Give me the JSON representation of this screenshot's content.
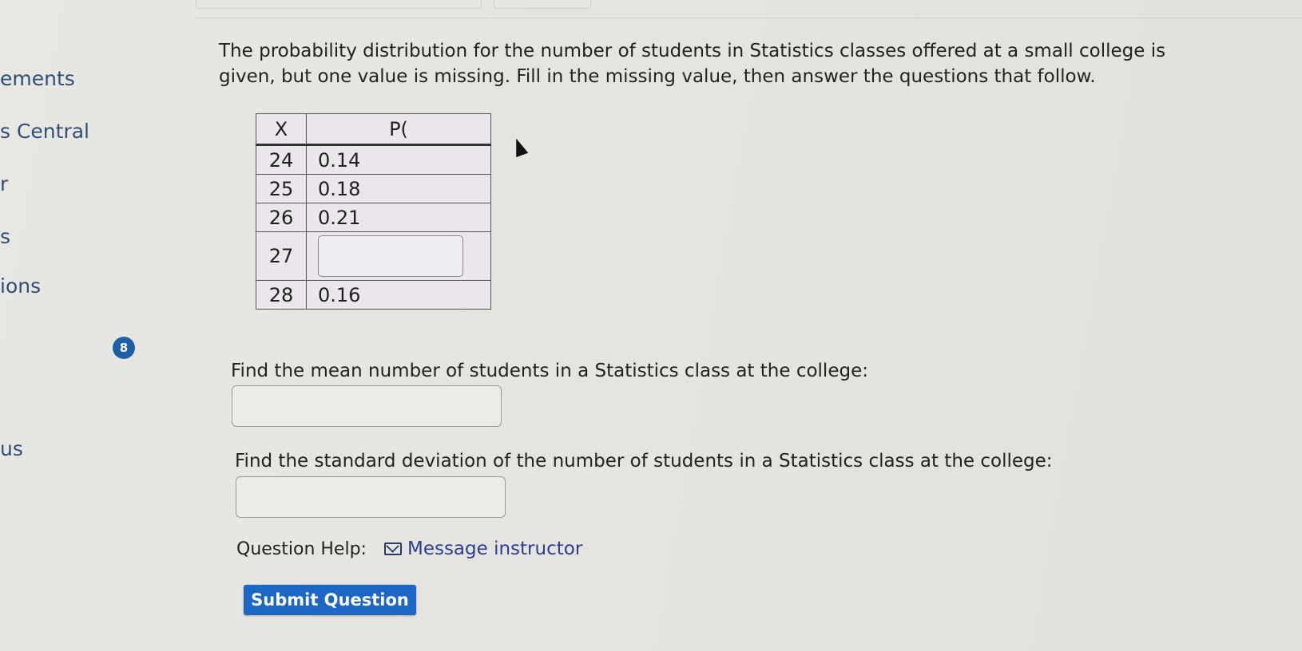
{
  "sidebar": {
    "items": [
      "ements",
      "s Central",
      "r",
      "s",
      "ions",
      "us"
    ]
  },
  "question": {
    "number": "8",
    "intro": "The probability distribution for the number of students in Statistics classes offered at a small college is given, but one value is missing. Fill in the missing value, then answer the questions that follow.",
    "table": {
      "header_x": "X",
      "header_p": "P(",
      "rows": [
        {
          "x": "24",
          "p": "0.14"
        },
        {
          "x": "25",
          "p": "0.18"
        },
        {
          "x": "26",
          "p": "0.21"
        },
        {
          "x": "27",
          "p": ""
        },
        {
          "x": "28",
          "p": "0.16"
        }
      ]
    },
    "mean_prompt": "Find the mean number of students in a Statistics class at the college:",
    "sd_prompt": "Find the standard deviation of the number of students in a Statistics class at the college:",
    "help_label": "Question Help:",
    "message_link": "Message instructor",
    "submit_label": "Submit Question"
  },
  "colors": {
    "accent": "#1c66c6",
    "link": "#2b3f8f",
    "badge": "#1e5fa8"
  }
}
